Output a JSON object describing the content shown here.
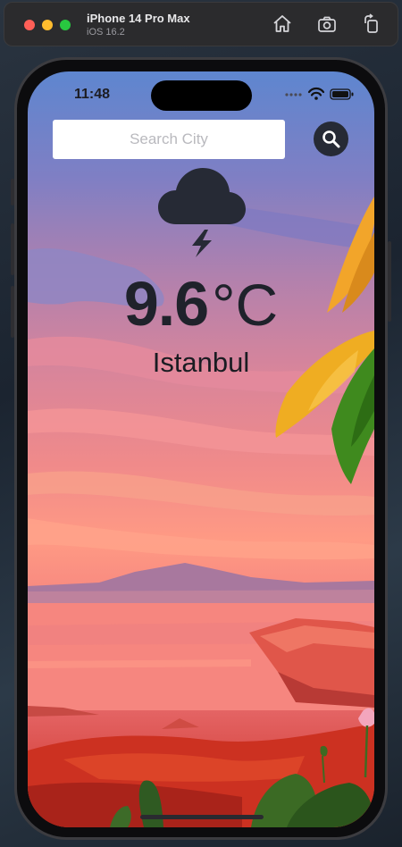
{
  "simulator": {
    "device_name": "iPhone 14 Pro Max",
    "os_version": "iOS 16.2",
    "toolbar_icons": [
      "home-icon",
      "screenshot-icon",
      "rotate-icon"
    ]
  },
  "status_bar": {
    "time": "11:48",
    "icons": [
      "cellular-dots-icon",
      "wifi-icon",
      "battery-icon"
    ]
  },
  "search": {
    "placeholder": "Search City",
    "value": "",
    "button_icon": "magnifier-icon"
  },
  "weather": {
    "condition_icon": "thunder-cloud-icon",
    "temperature": "9.6",
    "unit": "°C",
    "city": "Istanbul"
  },
  "colors": {
    "accent_dark": "#262a35",
    "text_dark": "#1f222b",
    "sky_top": "#5e86cf",
    "sky_pink": "#ff9a84"
  }
}
